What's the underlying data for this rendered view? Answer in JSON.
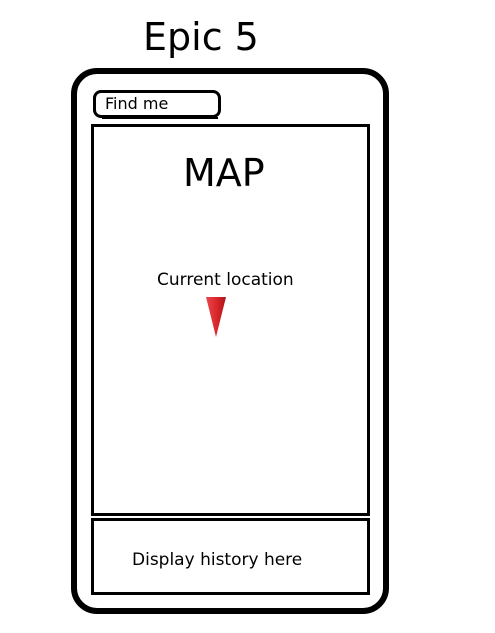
{
  "page": {
    "title": "Epic 5"
  },
  "toolbar": {
    "find_me_label": "Find me"
  },
  "map": {
    "label": "MAP",
    "current_location_label": "Current location",
    "marker_icon": "location-marker-icon",
    "marker_color": "#d9262a"
  },
  "history": {
    "label": "Display history here"
  }
}
